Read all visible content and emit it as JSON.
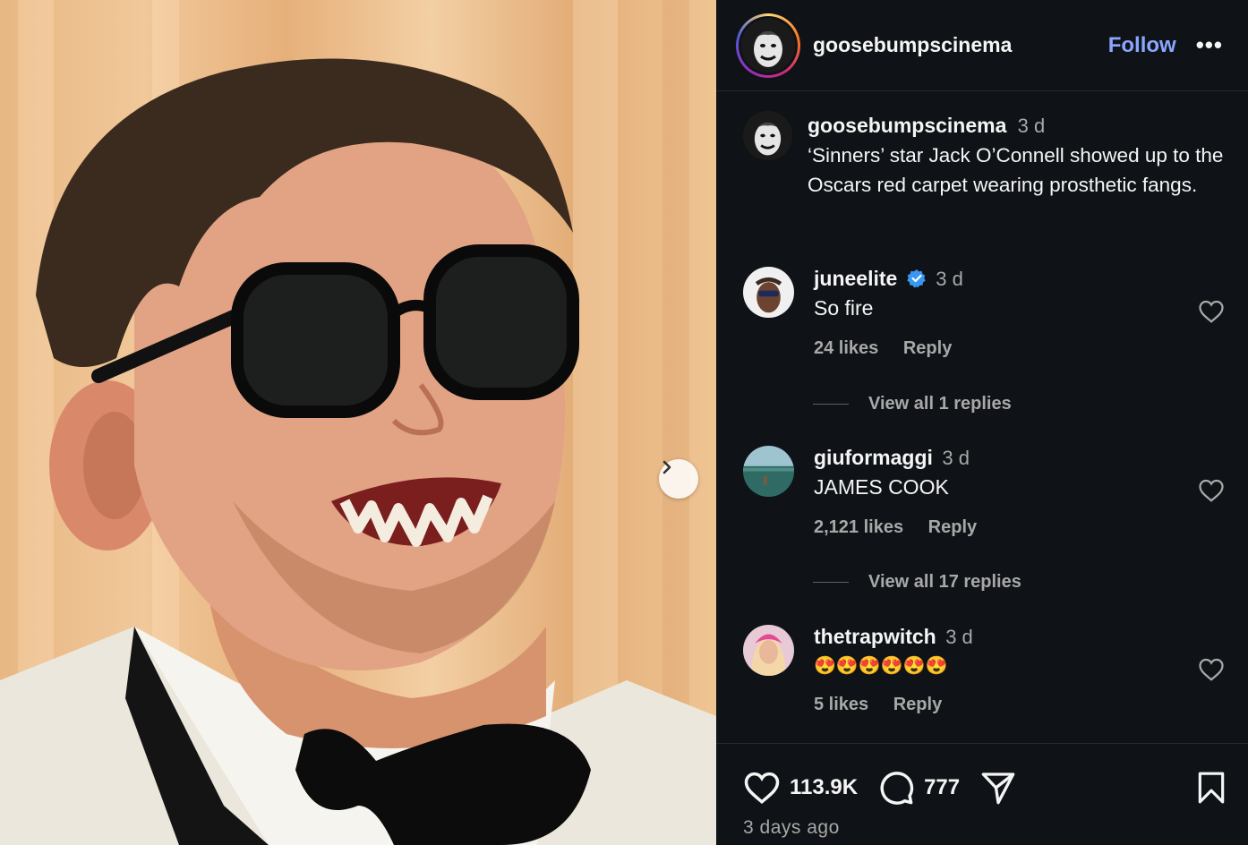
{
  "post": {
    "username": "goosebumpscinema",
    "follow_label": "Follow",
    "more_label": "•••",
    "caption_time": "3 d",
    "caption": "‘Sinners’ star Jack O’Connell showed up to the Oscars red carpet wearing prosthetic fangs."
  },
  "comments": [
    {
      "username": "juneelite",
      "verified": true,
      "time": "3 d",
      "text": "So fire",
      "likes": "24 likes",
      "reply_label": "Reply",
      "view_replies": "View all 1 replies"
    },
    {
      "username": "giuformaggi",
      "verified": false,
      "time": "3 d",
      "text": "JAMES COOK",
      "likes": "2,121 likes",
      "reply_label": "Reply",
      "view_replies": "View all 17 replies"
    },
    {
      "username": "thetrapwitch",
      "verified": false,
      "time": "3 d",
      "text": "😍😍😍😍😍😍",
      "likes": "5 likes",
      "reply_label": "Reply"
    }
  ],
  "actions": {
    "likes_count": "113.9K",
    "comments_count": "777",
    "posted_ago": "3 days ago"
  },
  "colors": {
    "accent_link": "#8aa6ff",
    "verified_blue": "#3897f0",
    "muted_text": "#a8a8a8",
    "panel_bg": "#0f1317"
  },
  "icons": [
    "chevron-right-icon",
    "more-icon",
    "verified-badge-icon",
    "heart-icon",
    "comment-icon",
    "share-icon",
    "bookmark-icon"
  ]
}
